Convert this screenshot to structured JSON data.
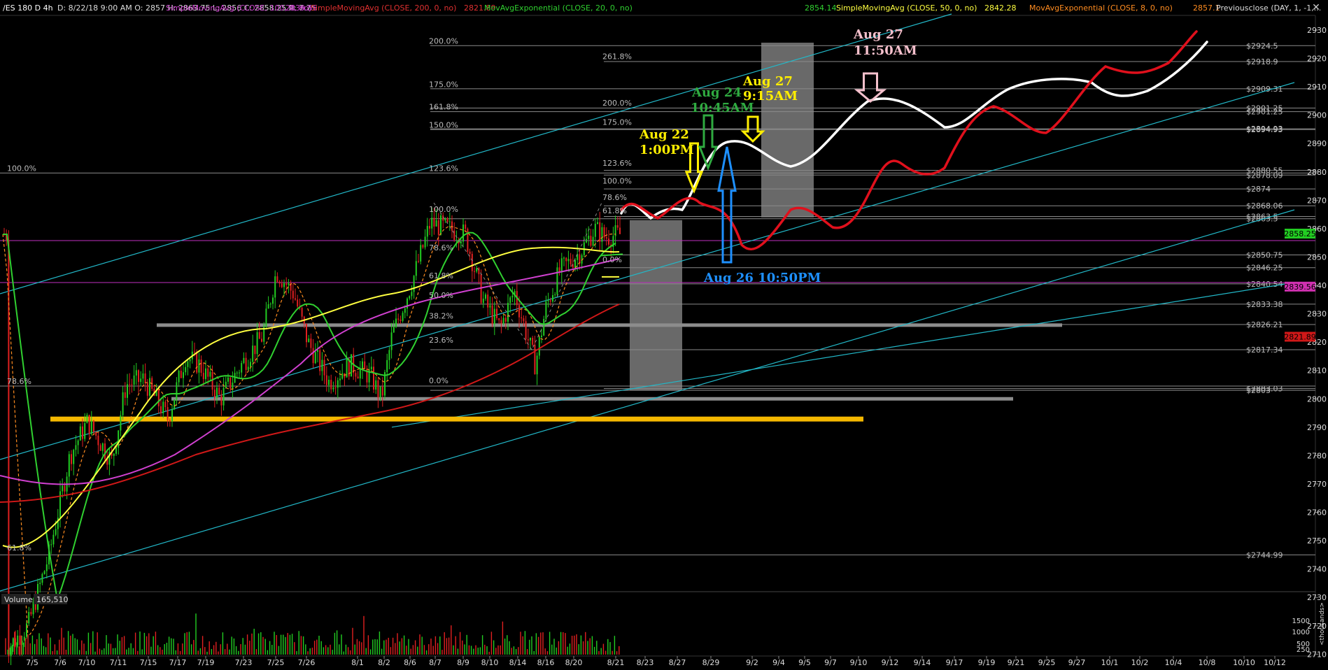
{
  "header": {
    "symbol": "/ES 180 D 4h",
    "ohlc": "D: 8/22/18 9:00 AM   O: 2857   H: 2863.75   L: 2856   C: 2858.25   R: 7.75",
    "studies": [
      {
        "label": "SimpleMovingAvg (CLOSE, 100, 0, no)",
        "value": "2839.56",
        "color": "#d040d0"
      },
      {
        "label": "SimpleMovingAvg (CLOSE, 200, 0, no)",
        "value": "2821.89",
        "color": "#e03030"
      },
      {
        "label": "MovAvgExponential (CLOSE, 20, 0, no)",
        "value": "2854.14",
        "color": "#30d030"
      },
      {
        "label": "SimpleMovingAvg (CLOSE, 50, 0, no)",
        "value": "2842.28",
        "color": "#ffff40"
      },
      {
        "label": "MovAvgExponential (CLOSE, 8, 0, no)",
        "value": "2857.1",
        "color": "#ff8c20"
      },
      {
        "label": "Previousclose (DAY, 1, -1,...",
        "value": "",
        "color": "#dddddd"
      }
    ]
  },
  "colors": {
    "background": "#000000",
    "up": "#22cc22",
    "down": "#e02020",
    "projection_white": "#ffffff",
    "projection_red": "#e0101c",
    "support_band": "#f5b800",
    "channel": "#22b8c8"
  },
  "chart_data": {
    "type": "candlestick",
    "y_ticks": [
      "2930",
      "2920",
      "2910",
      "2900",
      "2890",
      "2880",
      "2870",
      "2860",
      "2850",
      "2840",
      "2830",
      "2820",
      "2810",
      "2800",
      "2790",
      "2780",
      "2770",
      "2760",
      "2750",
      "2740",
      "2730",
      "2720",
      "2710"
    ],
    "ylim": [
      2705,
      2933
    ],
    "x_ticks": [
      "7/5",
      "7/6",
      "7/10",
      "7/11",
      "7/15",
      "7/17",
      "7/19",
      "7/23",
      "7/25",
      "7/26",
      "8/1",
      "8/2",
      "8/6",
      "8/7",
      "8/9",
      "8/10",
      "8/14",
      "8/16",
      "8/20",
      "8/21",
      "8/23",
      "8/27",
      "8/29",
      "9/2",
      "9/4",
      "9/5",
      "9/7",
      "9/10",
      "9/12",
      "9/14",
      "9/17",
      "9/19",
      "9/21",
      "9/25",
      "9/27",
      "10/1",
      "10/2",
      "10/4",
      "10/8",
      "10/10",
      "10/12"
    ],
    "price_levels": [
      {
        "label": "$2924.5",
        "value": 2924.5
      },
      {
        "label": "$2918.9",
        "value": 2918.9
      },
      {
        "label": "$2909.31",
        "value": 2909.31
      },
      {
        "label": "$2901.25",
        "value": 2902.5
      },
      {
        "label": "$2901.25",
        "value": 2901.25
      },
      {
        "label": "$2894.93",
        "value": 2895.2
      },
      {
        "label": "$2894.93",
        "value": 2894.93
      },
      {
        "label": "$2880.55",
        "value": 2880.55
      },
      {
        "label": "$2878.09",
        "value": 2878.9
      },
      {
        "label": "$2874",
        "value": 2874
      },
      {
        "label": "$2868.06",
        "value": 2868.06
      },
      {
        "label": "$2863.5",
        "value": 2864.3
      },
      {
        "label": "$2863.5",
        "value": 2863.5
      },
      {
        "label": "$2850.75",
        "value": 2850.75
      },
      {
        "label": "$2846.25",
        "value": 2846.25
      },
      {
        "label": "$2840.54",
        "value": 2840.54
      },
      {
        "label": "$2833.38",
        "value": 2833.38
      },
      {
        "label": "$2826.21",
        "value": 2826.21
      },
      {
        "label": "$2817.34",
        "value": 2817.34
      },
      {
        "label": "$2803.03",
        "value": 2803.6
      },
      {
        "label": "$2803",
        "value": 2803.0
      },
      {
        "label": "$2744.99",
        "value": 2744.99
      }
    ],
    "price_badges": [
      {
        "label": "2858.25",
        "value": 2858.25,
        "color": "#22cc22",
        "text_color": "#000000"
      },
      {
        "label": "2839.56",
        "value": 2839.56,
        "color": "#d030b0",
        "text_color": "#000000"
      },
      {
        "label": "2821.89",
        "value": 2821.89,
        "color": "#d01818",
        "text_color": "#000000"
      }
    ],
    "fib_labels_left": [
      {
        "label": "100.0%",
        "value": 2879.6
      },
      {
        "label": "78.6%",
        "value": 2804.5
      },
      {
        "label": "61.8%",
        "value": 2745.8
      }
    ],
    "fib_labels_mid": [
      {
        "label": "200.0%",
        "value": 2924.5
      },
      {
        "label": "175.0%",
        "value": 2909.2
      },
      {
        "label": "161.8%",
        "value": 2901.3
      },
      {
        "label": "150.0%",
        "value": 2894.9
      },
      {
        "label": "123.6%",
        "value": 2879.6
      },
      {
        "label": "100.0%",
        "value": 2865.2
      },
      {
        "label": "78.6%",
        "value": 2851.6
      },
      {
        "label": "61.8%",
        "value": 2841.7
      },
      {
        "label": "50.0%",
        "value": 2834.8
      },
      {
        "label": "38.2%",
        "value": 2827.6
      },
      {
        "label": "23.6%",
        "value": 2819.0
      },
      {
        "label": "0.0%",
        "value": 2804.8
      }
    ],
    "fib_labels_right": [
      {
        "label": "261.8%",
        "value": 2919.0
      },
      {
        "label": "200.0%",
        "value": 2902.6
      },
      {
        "label": "175.0%",
        "value": 2895.8
      },
      {
        "label": "123.6%",
        "value": 2881.4
      },
      {
        "label": "100.0%",
        "value": 2875.1
      },
      {
        "label": "78.6%",
        "value": 2869.3
      },
      {
        "label": "61.8%",
        "value": 2864.7
      },
      {
        "label": "0.0%",
        "value": 2847.4
      }
    ],
    "annotations": [
      {
        "line1": "Aug 22",
        "line2": "1:00PM",
        "color": "#ffee00"
      },
      {
        "line1": "Aug 24",
        "line2": "10:45AM",
        "color": "#2faa40"
      },
      {
        "line1": "Aug 27",
        "line2": "9:15AM",
        "color": "#ffee00"
      },
      {
        "line1": "Aug 27",
        "line2": "11:50AM",
        "color": "#f5c0cc"
      },
      {
        "line1": "Aug 26  10:50PM",
        "line2": "",
        "color": "#1e90ff"
      }
    ],
    "volume": {
      "label": "Volume",
      "value": "165,510",
      "ticks": [
        "1500",
        "1000",
        "500",
        "250"
      ],
      "axis_label": "<thousands>"
    }
  }
}
